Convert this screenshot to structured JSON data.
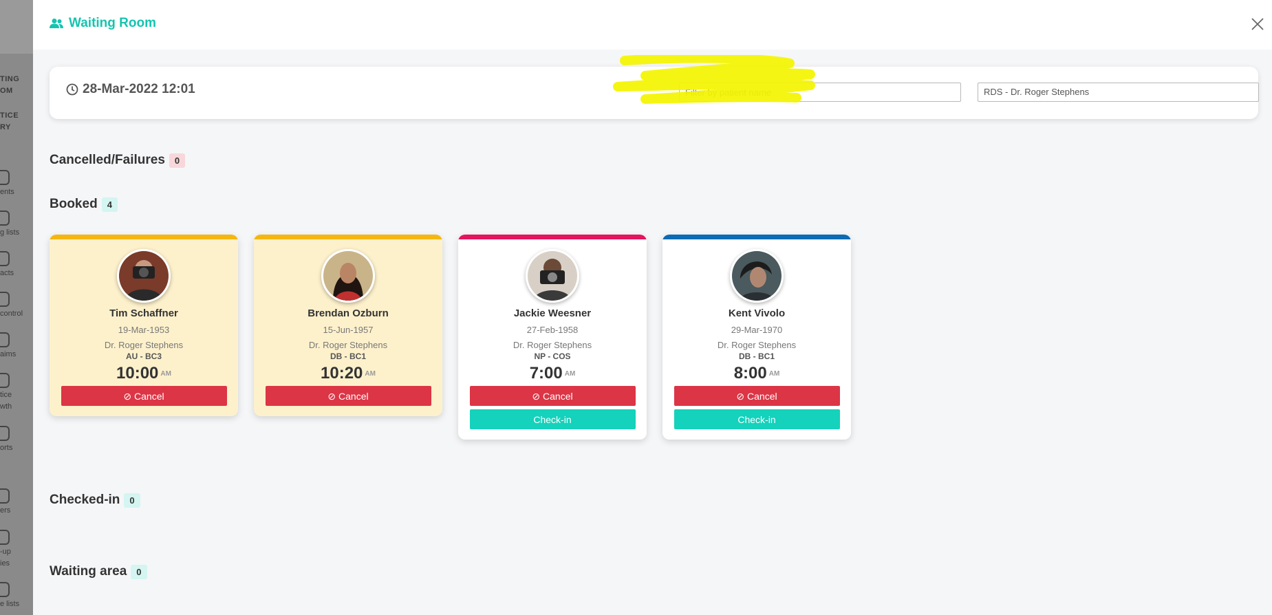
{
  "background_sidebar": {
    "items": [
      {
        "label": "TING"
      },
      {
        "label": "OM"
      },
      {
        "label": "TICE"
      },
      {
        "label": "RY"
      },
      {
        "label": "ents"
      },
      {
        "label": "g lists"
      },
      {
        "label": "acts"
      },
      {
        "label": "control"
      },
      {
        "label": "aims"
      },
      {
        "label": "tice"
      },
      {
        "label": "wth"
      },
      {
        "label": "orts"
      },
      {
        "label": "ers"
      },
      {
        "label": "-up"
      },
      {
        "label": "ies"
      },
      {
        "label": "e lists"
      }
    ]
  },
  "header": {
    "title": "Waiting Room",
    "icon": "people-icon",
    "close_icon": "close-icon"
  },
  "filters": {
    "datetime": "28-Mar-2022 12:01",
    "patient_filter": {
      "placeholder": "Filter by patient name",
      "value": ""
    },
    "doctor_select": {
      "value": "RDS - Dr. Roger Stephens"
    }
  },
  "sections": {
    "cancelled": {
      "title": "Cancelled/Failures",
      "count": "0"
    },
    "booked": {
      "title": "Booked",
      "count": "4"
    },
    "checked_in": {
      "title": "Checked-in",
      "count": "0"
    },
    "waiting": {
      "title": "Waiting area",
      "count": "0"
    }
  },
  "booked_cards": [
    {
      "name": "Tim Schaffner",
      "dob": "19-Mar-1953",
      "doctor": "Dr. Roger Stephens",
      "code": "AU - BC3",
      "time": "10:00",
      "ampm": "AM",
      "cancel_label": "Cancel",
      "accent": "#f5b70f",
      "bg": "#fdf1cc"
    },
    {
      "name": "Brendan Ozburn",
      "dob": "15-Jun-1957",
      "doctor": "Dr. Roger Stephens",
      "code": "DB - BC1",
      "time": "10:20",
      "ampm": "AM",
      "cancel_label": "Cancel",
      "accent": "#f5b70f",
      "bg": "#fdf1cc"
    },
    {
      "name": "Jackie Weesner",
      "dob": "27-Feb-1958",
      "doctor": "Dr. Roger Stephens",
      "code": "NP - COS",
      "time": "7:00",
      "ampm": "AM",
      "cancel_label": "Cancel",
      "checkin_label": "Check-in",
      "accent": "#e4145e",
      "bg": "#ffffff"
    },
    {
      "name": "Kent Vivolo",
      "dob": "29-Mar-1970",
      "doctor": "Dr. Roger Stephens",
      "code": "DB - BC1",
      "time": "8:00",
      "ampm": "AM",
      "cancel_label": "Cancel",
      "checkin_label": "Check-in",
      "accent": "#0b6bb5",
      "bg": "#ffffff"
    }
  ],
  "colors": {
    "brand_teal": "#14c4b0",
    "cancel_red": "#dc3545",
    "checkin_teal": "#14d2bb"
  }
}
